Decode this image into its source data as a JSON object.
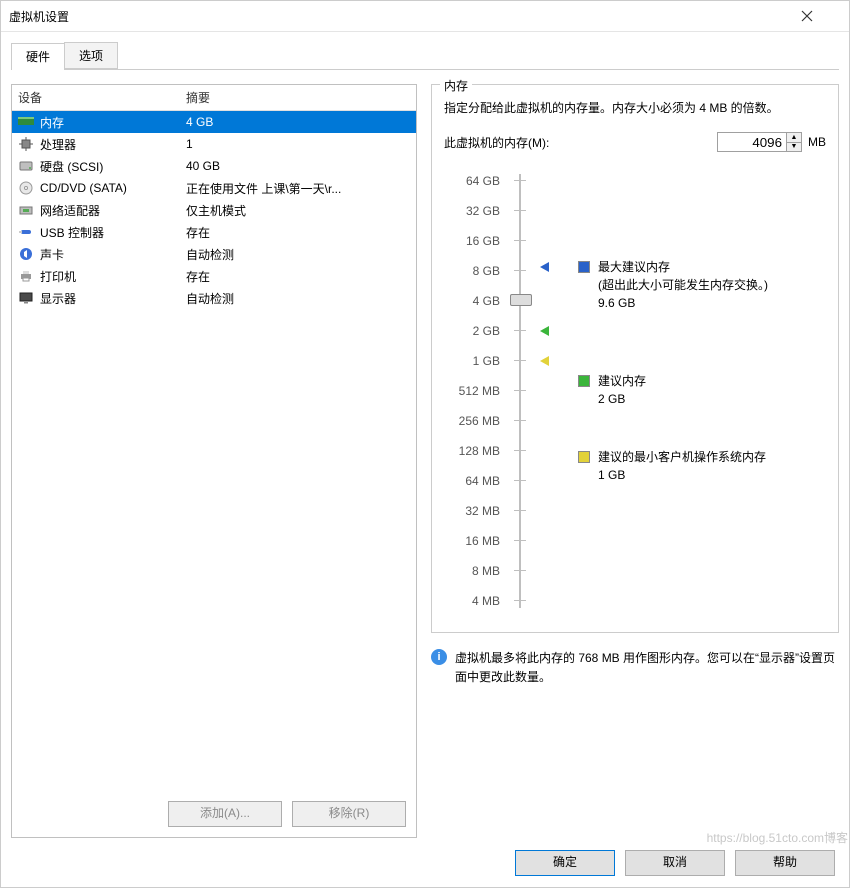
{
  "window": {
    "title": "虚拟机设置"
  },
  "tabs": {
    "hardware": "硬件",
    "options": "选项"
  },
  "device_table": {
    "headers": {
      "device": "设备",
      "summary": "摘要"
    },
    "rows": [
      {
        "icon": "memory-icon",
        "name": "内存",
        "summary": "4 GB",
        "selected": true
      },
      {
        "icon": "cpu-icon",
        "name": "处理器",
        "summary": "1"
      },
      {
        "icon": "disk-icon",
        "name": "硬盘 (SCSI)",
        "summary": "40 GB"
      },
      {
        "icon": "cd-icon",
        "name": "CD/DVD (SATA)",
        "summary": "正在使用文件 上课\\第一天\\r..."
      },
      {
        "icon": "nic-icon",
        "name": "网络适配器",
        "summary": "仅主机模式"
      },
      {
        "icon": "usb-icon",
        "name": "USB 控制器",
        "summary": "存在"
      },
      {
        "icon": "sound-icon",
        "name": "声卡",
        "summary": "自动检测"
      },
      {
        "icon": "printer-icon",
        "name": "打印机",
        "summary": "存在"
      },
      {
        "icon": "display-icon",
        "name": "显示器",
        "summary": "自动检测"
      }
    ]
  },
  "buttons": {
    "add": "添加(A)...",
    "remove": "移除(R)",
    "ok": "确定",
    "cancel": "取消",
    "help": "帮助"
  },
  "memory": {
    "section_title": "内存",
    "description": "指定分配给此虚拟机的内存量。内存大小必须为 4 MB 的倍数。",
    "field_label": "此虚拟机的内存(M):",
    "value": "4096",
    "unit": "MB",
    "ticks": [
      "64 GB",
      "32 GB",
      "16 GB",
      "8 GB",
      "4 GB",
      "2 GB",
      "1 GB",
      "512 MB",
      "256 MB",
      "128 MB",
      "64 MB",
      "32 MB",
      "16 MB",
      "8 MB",
      "4 MB"
    ],
    "legend": {
      "max": {
        "title": "最大建议内存",
        "note": "(超出此大小可能发生内存交换。)",
        "value": "9.6 GB",
        "color": "#2a62c9"
      },
      "rec": {
        "title": "建议内存",
        "value": "2 GB",
        "color": "#3bb53b"
      },
      "min": {
        "title": "建议的最小客户机操作系统内存",
        "value": "1 GB",
        "color": "#e2d23a"
      }
    },
    "info": "虚拟机最多将此内存的 768 MB 用作图形内存。您可以在“显示器”设置页面中更改此数量。"
  },
  "watermark": "https://blog.51cto.com博客"
}
